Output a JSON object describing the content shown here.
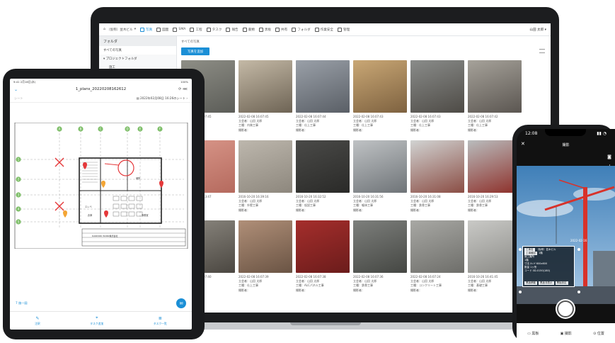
{
  "laptop": {
    "topbar": {
      "project": "（仮称）並木ビル",
      "menu": [
        "写真",
        "図面",
        "SMA",
        "工程",
        "タスク",
        "報告",
        "書類",
        "黒板",
        "共有",
        "フォルダ",
        "作業安全",
        "管理"
      ],
      "active_index": 0,
      "user": "山田 太郎"
    },
    "folder_panel": {
      "heading": "フォルダ",
      "items": [
        "すべての写真",
        "▾ プロジェクトフォルダ",
        "施工"
      ]
    },
    "breadcrumb": "すべての写真",
    "add_button": "写真を追加",
    "photos": [
      {
        "date": "2022-02-08 16:07:45",
        "lines": [
          "立会者：山田 太郎",
          "工種：内装工事",
          "撮影者："
        ],
        "colors": [
          "#8e8e86",
          "#5c5d58"
        ]
      },
      {
        "date": "2022-02-08 16:07:45",
        "lines": [
          "立会者：山田 太郎",
          "工種：内装工事",
          "撮影者："
        ],
        "colors": [
          "#c4b9a6",
          "#6e6455"
        ]
      },
      {
        "date": "2022-02-08 16:07:44",
        "lines": [
          "立会者：山田 太郎",
          "工種：仕上工事",
          "撮影者："
        ],
        "colors": [
          "#9aa0a8",
          "#5a5f66"
        ]
      },
      {
        "date": "2022-02-08 16:07:43",
        "lines": [
          "立会者：山田 太郎",
          "工種：仕上工事",
          "撮影者："
        ],
        "colors": [
          "#c9a775",
          "#7e6240"
        ]
      },
      {
        "date": "2022-02-08 16:07:43",
        "lines": [
          "立会者：山田 太郎",
          "工種：仕上工事",
          "撮影者："
        ],
        "colors": [
          "#8a8c8a",
          "#4e4b46"
        ]
      },
      {
        "date": "2022-02-08 16:07:42",
        "lines": [
          "立会者：山田 太郎",
          "工種：仕上工事",
          "撮影者："
        ],
        "colors": [
          "#a6a29a",
          "#5b5651"
        ]
      },
      {
        "date": "2016-10-20 16:43:47",
        "lines": [
          "立会者：山田 太郎",
          "工種：内装工事",
          "撮影者："
        ],
        "colors": [
          "#d9978a",
          "#b56a5e"
        ]
      },
      {
        "date": "2016-10-20 16:39:16",
        "lines": [
          "立会者：山田 太郎",
          "工種：外壁工事",
          "撮影者："
        ],
        "colors": [
          "#bdb7ad",
          "#8d877d"
        ]
      },
      {
        "date": "2016-10-20 16:32:52",
        "lines": [
          "立会者：山田 太郎",
          "工種：仮設工事",
          "撮影者："
        ],
        "colors": [
          "#4a4a48",
          "#2a2a28"
        ]
      },
      {
        "date": "2016-10-20 16:31:56",
        "lines": [
          "立会者：山田 太郎",
          "工種：躯体工事",
          "撮影者："
        ],
        "colors": [
          "#bfc2c4",
          "#6f7478"
        ]
      },
      {
        "date": "2016-10-20 16:31:08",
        "lines": [
          "立会者：山田 太郎",
          "工種：鉄骨工事",
          "撮影者："
        ],
        "colors": [
          "#d1d3d2",
          "#8b4e45"
        ]
      },
      {
        "date": "2016-10-20 16:29:53",
        "lines": [
          "立会者：山田 太郎",
          "工種：鉄骨工事",
          "撮影者："
        ],
        "colors": [
          "#b9bcbd",
          "#8d2d27"
        ]
      },
      {
        "date": "2016-10-20 16:07:40",
        "lines": [
          "立会者：山田 太郎",
          "工種：内装工事",
          "撮影者："
        ],
        "colors": [
          "#8c8880",
          "#4b4741"
        ]
      },
      {
        "date": "2022-02-08 16:07:39",
        "lines": [
          "立会者：山田 太郎",
          "工種：仕上工事",
          "撮影者："
        ],
        "colors": [
          "#b08f78",
          "#6a5444"
        ]
      },
      {
        "date": "2022-02-08 16:07:38",
        "lines": [
          "立会者：山田 太郎",
          "工種：ALCパネル工事",
          "撮影者："
        ],
        "colors": [
          "#a52e2c",
          "#6b1c1b"
        ]
      },
      {
        "date": "2022-02-08 16:07:36",
        "lines": [
          "立会者：山田 太郎",
          "工種：鉄骨工事",
          "撮影者："
        ],
        "colors": [
          "#7d7f7c",
          "#454743"
        ]
      },
      {
        "date": "2022-02-08 16:07:24",
        "lines": [
          "立会者：山田 太郎",
          "工種：コンクリート工事",
          "撮影者："
        ],
        "colors": [
          "#a8a8a4",
          "#6e6e6a"
        ]
      },
      {
        "date": "2016-10-26 16:41:45",
        "lines": [
          "立会者：山田 太郎",
          "工種：基礎工事",
          "撮影者："
        ],
        "colors": [
          "#c9c9c6",
          "#8a8a86"
        ]
      }
    ]
  },
  "tablet": {
    "status_left": "9:41 2月16日(水)",
    "status_right": "100%",
    "title": "1_plans_20220208162612",
    "sheet_left": "シート",
    "sheet_right": "2022年02月08日 16:26のシート",
    "link": "7 施一図",
    "tabs": [
      "注釈",
      "タスク追加",
      "タスク一覧"
    ],
    "grid_letters": [
      "A",
      "B",
      "C",
      "D",
      "E",
      "F"
    ],
    "grid_numbers": [
      "1",
      "2",
      "3",
      "4",
      "5"
    ],
    "plan_labels": [
      "エレベ",
      "便所",
      "倉庫",
      "事務室"
    ],
    "title_block": "DANDORI WORK株式会社"
  },
  "phone": {
    "time": "12:08",
    "header": "撮影",
    "board": {
      "row1": [
        "工事名",
        "（仮称）並木ビル"
      ],
      "row2": [
        "工事種目",
        "1階"
      ],
      "lines": [
        "施工箇所",
        "1階",
        "寸法 X=Y 600x600",
        "数量 1ヶ所",
        "コード 0D-0150(180)",
        "2022-02-16"
      ],
      "buttons": [
        "黒板移動",
        "黒板非表示",
        "黒板設定",
        "元に戻す"
      ]
    },
    "tabs": [
      "黒板",
      "撮影",
      "位置"
    ],
    "colors": {
      "sky_top": "#3f7fb8",
      "sky_bottom": "#a9c9e6",
      "crane": "#d8322a"
    }
  },
  "colors": {
    "accent": "#1b8fd6",
    "device": "#1c1d1f"
  }
}
